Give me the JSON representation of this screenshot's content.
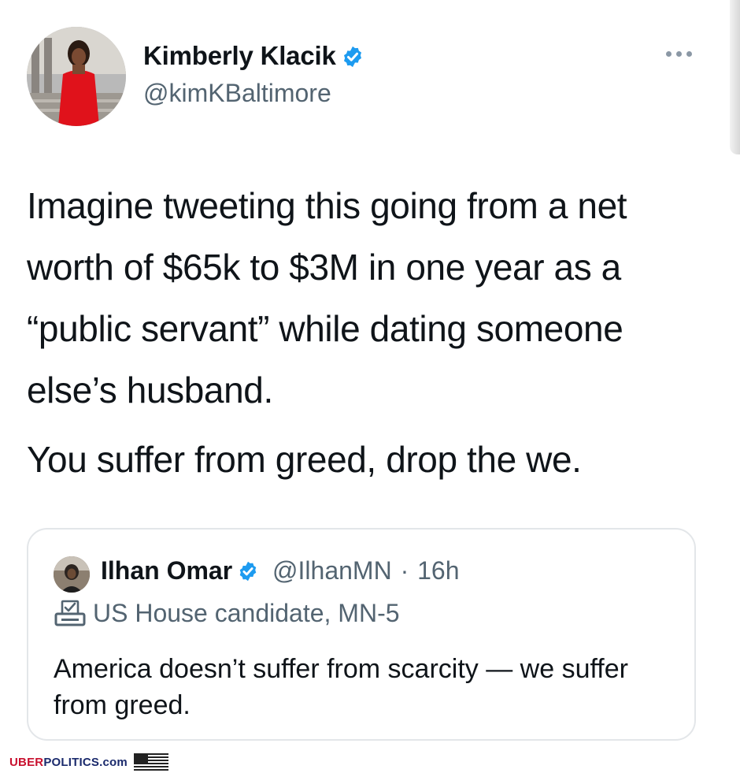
{
  "tweet": {
    "author_name": "Kimberly Klacik",
    "author_handle": "@kimKBaltimore",
    "paragraphs": [
      "Imagine tweeting this going from a net worth of $65k to $3M in one year as a “public servant” while dating someone else’s husband.",
      "You suffer from greed, drop the we."
    ],
    "more_icon": "more-horizontal-icon",
    "verified_icon": "verified-badge-icon"
  },
  "quoted_tweet": {
    "author_name": "Ilhan Omar",
    "author_handle": "@IlhanMN",
    "separator": "·",
    "time": "16h",
    "label_icon": "ballot-box-icon",
    "label": "US House candidate, MN-5",
    "text": "America doesn’t suffer from scarcity — we suffer from greed."
  },
  "footer": {
    "brand_prefix": "UBER",
    "brand_suffix": "POLITICS.com",
    "flag_icon": "us-flag-icon"
  },
  "colors": {
    "verified_blue": "#1d9bf0",
    "secondary_text": "#536471",
    "brand_red": "#c8102e",
    "brand_navy": "#1a2a6c"
  }
}
